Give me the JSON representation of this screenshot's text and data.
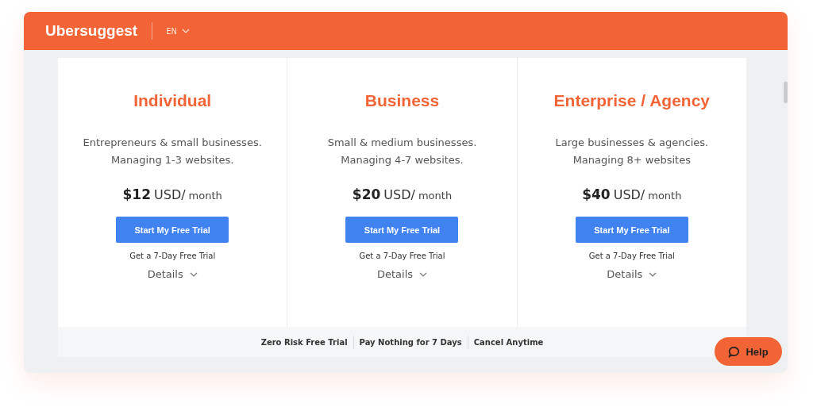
{
  "header": {
    "logo": "Ubersuggest",
    "language": "EN"
  },
  "plans": [
    {
      "name": "Individual",
      "description": [
        "Entrepreneurs & small businesses.",
        "Managing 1-3 websites."
      ],
      "price": "$12",
      "currency": "USD/",
      "period": "month",
      "button": "Start My Free Trial",
      "note": "Get a 7-Day Free Trial",
      "details": "Details"
    },
    {
      "name": "Business",
      "description": [
        "Small & medium businesses.",
        "Managing 4-7 websites."
      ],
      "price": "$20",
      "currency": "USD/",
      "period": "month",
      "button": "Start My Free Trial",
      "note": "Get a 7-Day Free Trial",
      "details": "Details"
    },
    {
      "name": "Enterprise / Agency",
      "description": [
        "Large businesses & agencies.",
        "Managing 8+ websites"
      ],
      "price": "$40",
      "currency": "USD/",
      "period": "month",
      "button": "Start My Free Trial",
      "note": "Get a 7-Day Free Trial",
      "details": "Details"
    }
  ],
  "guarantees": [
    "Zero Risk Free Trial",
    "Pay Nothing for 7 Days",
    "Cancel Anytime"
  ],
  "help_button": "Help"
}
